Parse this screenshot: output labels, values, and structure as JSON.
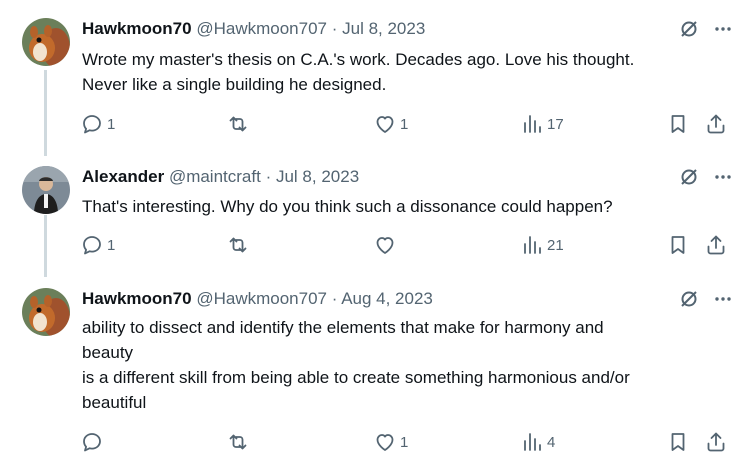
{
  "posts": [
    {
      "author_name": "Hawkmoon70",
      "handle": "@Hawkmoon707",
      "separator": "·",
      "date": "Jul 8, 2023",
      "lines": [
        "Wrote my master's thesis on C.A.'s work.  Decades ago. Love his thought.",
        "Never like a single building he designed."
      ],
      "reply_count": "1",
      "repost_count": "",
      "like_count": "1",
      "view_count": "17",
      "avatar": "squirrel"
    },
    {
      "author_name": "Alexander",
      "handle": "@maintcraft",
      "separator": "·",
      "date": "Jul 8, 2023",
      "lines": [
        "That's interesting. Why do you think such a dissonance could happen?"
      ],
      "reply_count": "1",
      "repost_count": "",
      "like_count": "",
      "view_count": "21",
      "avatar": "person"
    },
    {
      "author_name": "Hawkmoon70",
      "handle": "@Hawkmoon707",
      "separator": "·",
      "date": "Aug 4, 2023",
      "lines": [
        "ability to dissect and identify the elements that make for harmony and",
        "beauty",
        "is a different skill from being able to create something harmonious and/or",
        "beautiful"
      ],
      "reply_count": "",
      "repost_count": "",
      "like_count": "1",
      "view_count": "4",
      "avatar": "squirrel"
    }
  ],
  "icons": {
    "grok": "grok-icon",
    "more": "more-icon",
    "reply": "reply-icon",
    "repost": "repost-icon",
    "like": "like-icon",
    "views": "views-icon",
    "bookmark": "bookmark-icon",
    "share": "share-icon"
  },
  "colors": {
    "text": "#0f1419",
    "secondary": "#536471",
    "thread_line": "#cfd9de"
  }
}
